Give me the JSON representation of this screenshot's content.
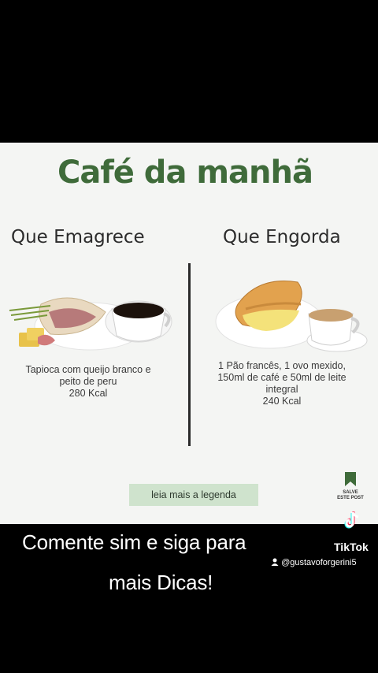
{
  "card": {
    "title": "Café da manhã",
    "left_heading": "Que Emagrece",
    "right_heading": "Que Engorda",
    "left_desc": [
      "Tapioca com queijo branco e",
      "peito de peru",
      "280 Kcal"
    ],
    "right_desc": [
      "1 Pão francês, 1 ovo mexido,",
      "150ml de café e 50ml de leite",
      "integral",
      "240 Kcal"
    ],
    "legend_button": "leia mais a legenda",
    "save_label_1": "SALVE",
    "save_label_2": "ESTE POST"
  },
  "overlay": {
    "caption_line1": "Comente sim e siga para",
    "caption_line2": "mais Dicas!",
    "brand": "TikTok",
    "handle": "@gustavoforgerini5"
  },
  "colors": {
    "title_green": "#3f6b3a",
    "button_green": "#cfe3cd",
    "background": "#000000"
  },
  "icons": [
    "bookmark-icon",
    "tiktok-logo-icon",
    "user-icon"
  ]
}
